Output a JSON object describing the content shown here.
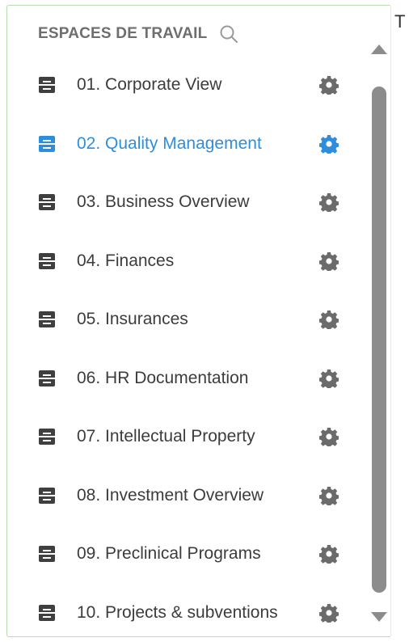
{
  "header": {
    "title": "ESPACES DE TRAVAIL",
    "search_icon": "search-icon"
  },
  "edge_text": "T",
  "colors": {
    "default_icon": "#3f3f3f",
    "active": "#2e8ede",
    "gear": "#6b6b6b",
    "scrollbar": "#8c8c8c"
  },
  "workspaces": [
    {
      "label": "01. Corporate View",
      "active": false
    },
    {
      "label": "02. Quality Management",
      "active": true
    },
    {
      "label": "03. Business Overview",
      "active": false
    },
    {
      "label": "04. Finances",
      "active": false
    },
    {
      "label": "05. Insurances",
      "active": false
    },
    {
      "label": "06. HR Documentation",
      "active": false
    },
    {
      "label": "07. Intellectual Property",
      "active": false
    },
    {
      "label": "08. Investment Overview",
      "active": false
    },
    {
      "label": "09. Preclinical Programs",
      "active": false
    },
    {
      "label": "10. Projects & subventions",
      "active": false
    }
  ]
}
